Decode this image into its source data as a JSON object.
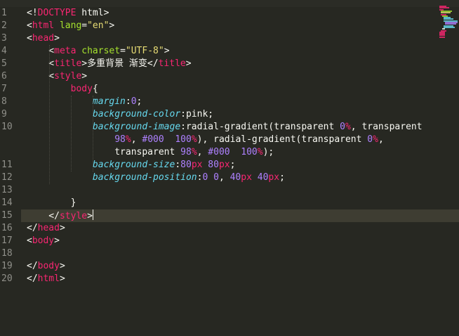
{
  "editor": {
    "active_line": 15,
    "lines": [
      {
        "num": "1",
        "segments": [
          {
            "c": "w",
            "t": "<!"
          },
          {
            "c": "tag",
            "t": "DOCTYPE"
          },
          {
            "c": "w",
            "t": " html>"
          }
        ]
      },
      {
        "num": "2",
        "segments": [
          {
            "c": "w",
            "t": "<"
          },
          {
            "c": "tag",
            "t": "html"
          },
          {
            "c": "w",
            "t": " "
          },
          {
            "c": "attr",
            "t": "lang"
          },
          {
            "c": "w",
            "t": "="
          },
          {
            "c": "str",
            "t": "\"en\""
          },
          {
            "c": "w",
            "t": ">"
          }
        ]
      },
      {
        "num": "3",
        "segments": [
          {
            "c": "w",
            "t": "<"
          },
          {
            "c": "tag",
            "t": "head"
          },
          {
            "c": "w",
            "t": ">"
          }
        ]
      },
      {
        "num": "4",
        "segments": [
          {
            "c": "w",
            "t": "    <"
          },
          {
            "c": "tag",
            "t": "meta"
          },
          {
            "c": "w",
            "t": " "
          },
          {
            "c": "attr",
            "t": "charset"
          },
          {
            "c": "w",
            "t": "="
          },
          {
            "c": "str",
            "t": "\"UTF-8\""
          },
          {
            "c": "w",
            "t": ">"
          }
        ]
      },
      {
        "num": "5",
        "segments": [
          {
            "c": "w",
            "t": "    <"
          },
          {
            "c": "tag",
            "t": "title"
          },
          {
            "c": "w",
            "t": ">多重背景 渐变</"
          },
          {
            "c": "tag",
            "t": "title"
          },
          {
            "c": "w",
            "t": ">"
          }
        ]
      },
      {
        "num": "6",
        "segments": [
          {
            "c": "w",
            "t": "    <"
          },
          {
            "c": "tag",
            "t": "style"
          },
          {
            "c": "w",
            "t": ">"
          }
        ]
      },
      {
        "num": "7",
        "segments": [
          {
            "c": "w",
            "t": "        "
          },
          {
            "c": "tag",
            "t": "body"
          },
          {
            "c": "w",
            "t": "{"
          }
        ]
      },
      {
        "num": "8",
        "segments": [
          {
            "c": "w",
            "t": "            "
          },
          {
            "c": "prop",
            "t": "margin"
          },
          {
            "c": "w",
            "t": ":"
          },
          {
            "c": "num",
            "t": "0"
          },
          {
            "c": "w",
            "t": ";"
          }
        ]
      },
      {
        "num": "9",
        "segments": [
          {
            "c": "w",
            "t": "            "
          },
          {
            "c": "prop",
            "t": "background-color"
          },
          {
            "c": "w",
            "t": ":pink;"
          }
        ]
      },
      {
        "num": "10",
        "segments": [
          {
            "c": "w",
            "t": "            "
          },
          {
            "c": "prop",
            "t": "background-image"
          },
          {
            "c": "w",
            "t": ":radial-gradient(transparent "
          },
          {
            "c": "num",
            "t": "0"
          },
          {
            "c": "tag",
            "t": "%"
          },
          {
            "c": "w",
            "t": ", transparent"
          }
        ]
      },
      {
        "num": "",
        "segments": [
          {
            "c": "w",
            "t": "                "
          },
          {
            "c": "num",
            "t": "98"
          },
          {
            "c": "tag",
            "t": "%"
          },
          {
            "c": "w",
            "t": ", "
          },
          {
            "c": "num",
            "t": "#000"
          },
          {
            "c": "w",
            "t": "  "
          },
          {
            "c": "num",
            "t": "100"
          },
          {
            "c": "tag",
            "t": "%"
          },
          {
            "c": "w",
            "t": "), radial-gradient(transparent "
          },
          {
            "c": "num",
            "t": "0"
          },
          {
            "c": "tag",
            "t": "%"
          },
          {
            "c": "w",
            "t": ","
          }
        ]
      },
      {
        "num": "",
        "segments": [
          {
            "c": "w",
            "t": "                transparent "
          },
          {
            "c": "num",
            "t": "98"
          },
          {
            "c": "tag",
            "t": "%"
          },
          {
            "c": "w",
            "t": ", "
          },
          {
            "c": "num",
            "t": "#000"
          },
          {
            "c": "w",
            "t": "  "
          },
          {
            "c": "num",
            "t": "100"
          },
          {
            "c": "tag",
            "t": "%"
          },
          {
            "c": "w",
            "t": ");"
          }
        ]
      },
      {
        "num": "11",
        "segments": [
          {
            "c": "w",
            "t": "            "
          },
          {
            "c": "prop",
            "t": "background-size"
          },
          {
            "c": "w",
            "t": ":"
          },
          {
            "c": "num",
            "t": "80"
          },
          {
            "c": "tag",
            "t": "px"
          },
          {
            "c": "w",
            "t": " "
          },
          {
            "c": "num",
            "t": "80"
          },
          {
            "c": "tag",
            "t": "px"
          },
          {
            "c": "w",
            "t": ";"
          }
        ]
      },
      {
        "num": "12",
        "segments": [
          {
            "c": "w",
            "t": "            "
          },
          {
            "c": "prop",
            "t": "background-position"
          },
          {
            "c": "w",
            "t": ":"
          },
          {
            "c": "num",
            "t": "0"
          },
          {
            "c": "w",
            "t": " "
          },
          {
            "c": "num",
            "t": "0"
          },
          {
            "c": "w",
            "t": ", "
          },
          {
            "c": "num",
            "t": "40"
          },
          {
            "c": "tag",
            "t": "px"
          },
          {
            "c": "w",
            "t": " "
          },
          {
            "c": "num",
            "t": "40"
          },
          {
            "c": "tag",
            "t": "px"
          },
          {
            "c": "w",
            "t": ";"
          }
        ]
      },
      {
        "num": "13",
        "segments": []
      },
      {
        "num": "14",
        "segments": [
          {
            "c": "w",
            "t": "        }"
          }
        ]
      },
      {
        "num": "15",
        "segments": [
          {
            "c": "w",
            "t": "    </"
          },
          {
            "c": "tag",
            "t": "style"
          },
          {
            "c": "w",
            "t": ">"
          }
        ],
        "cursor": true
      },
      {
        "num": "16",
        "segments": [
          {
            "c": "w",
            "t": "</"
          },
          {
            "c": "tag",
            "t": "head"
          },
          {
            "c": "w",
            "t": ">"
          }
        ]
      },
      {
        "num": "17",
        "segments": [
          {
            "c": "w",
            "t": "<"
          },
          {
            "c": "tag",
            "t": "body"
          },
          {
            "c": "w",
            "t": ">"
          }
        ]
      },
      {
        "num": "18",
        "segments": []
      },
      {
        "num": "19",
        "segments": [
          {
            "c": "w",
            "t": "</"
          },
          {
            "c": "tag",
            "t": "body"
          },
          {
            "c": "w",
            "t": ">"
          }
        ]
      },
      {
        "num": "20",
        "segments": [
          {
            "c": "w",
            "t": "</"
          },
          {
            "c": "tag",
            "t": "html"
          },
          {
            "c": "w",
            "t": ">"
          }
        ]
      }
    ]
  },
  "theme": {
    "background": "#272822",
    "active_line_bg": "#3e3d32",
    "gutter_text": "#90908a",
    "tag": "#f92672",
    "attr": "#a6e22e",
    "string": "#e6db74",
    "property": "#66d9ef",
    "number": "#ae81ff",
    "text": "#f8f8f2"
  },
  "minimap": {
    "icon": "minimap-icon"
  }
}
